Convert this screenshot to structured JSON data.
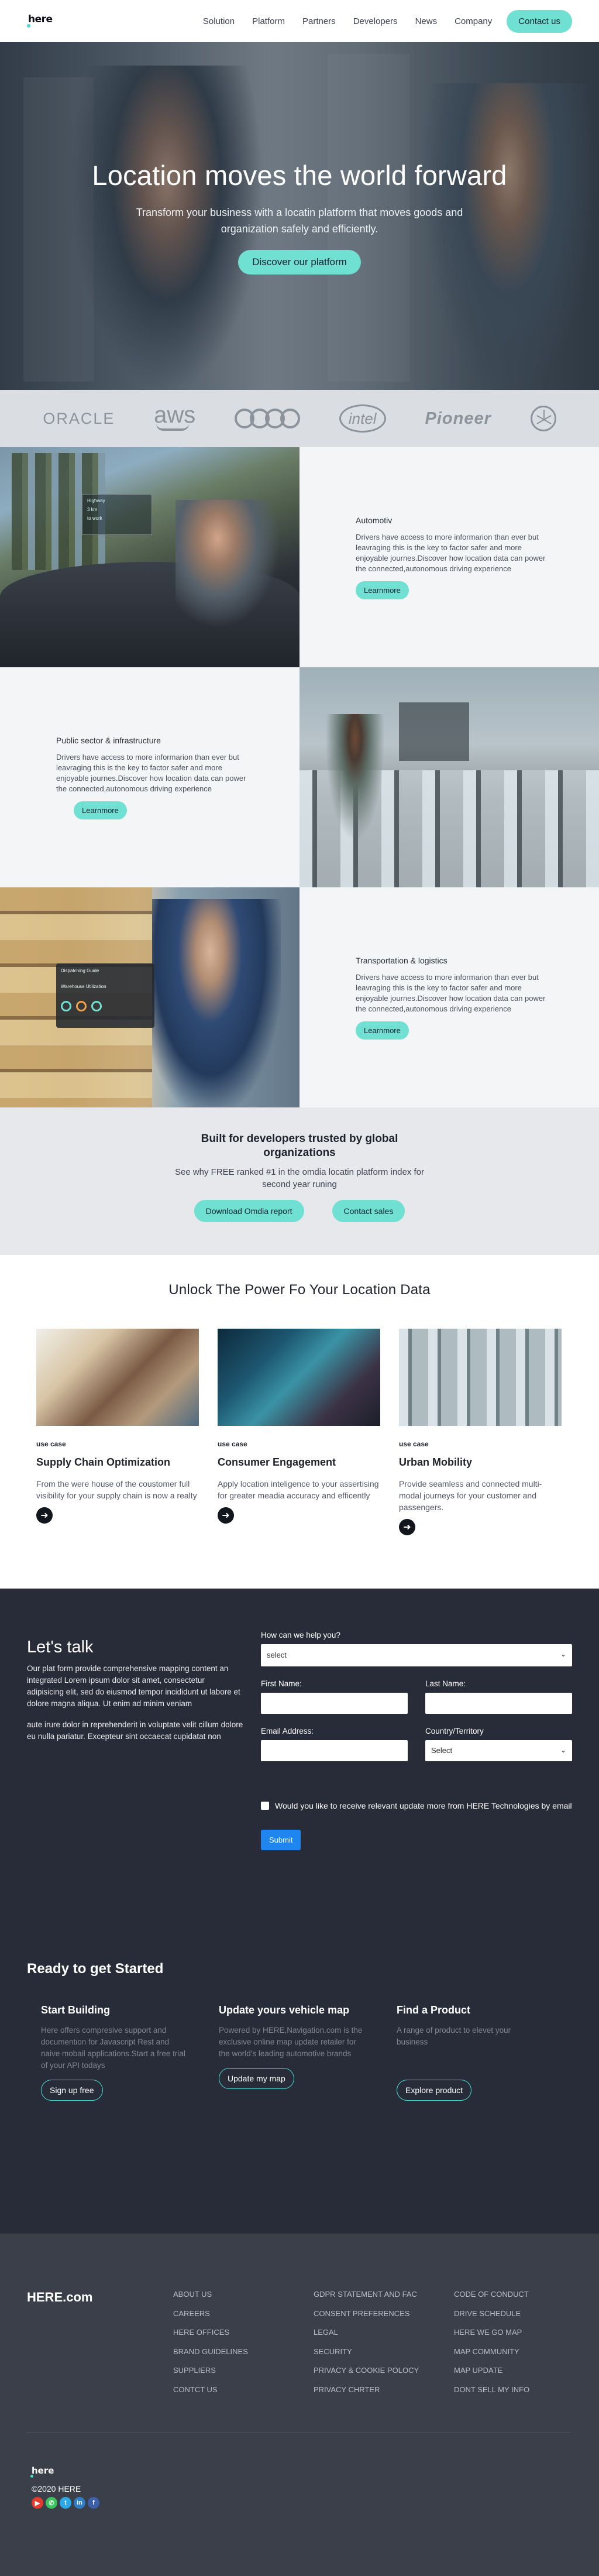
{
  "nav": {
    "logo": "here",
    "links": [
      "Solution",
      "Platform",
      "Partners",
      "Developers",
      "News",
      "Company"
    ],
    "cta": "Contact us"
  },
  "hero": {
    "title": "Location moves the world forward",
    "subtitle": "Transform your business with a locatin platform that moves goods and organization safely and efficiently.",
    "button": "Discover our platform"
  },
  "partners": [
    "ORACLE",
    "aws",
    "audi",
    "intel",
    "Pioneer",
    "mercedes"
  ],
  "industries": [
    {
      "title": "Automotiv",
      "body": "Drivers have access to more informarion than ever but leavraging this is the key to factor safer and more enjoyable journes.Discover how location data can power the connected,autonomous driving experience",
      "button": "Learnmore",
      "hud": [
        "Highway",
        "3 km",
        "to work"
      ]
    },
    {
      "title": "Public sector & infrastructure",
      "body": "Drivers have access to more informarion than ever but leavraging this is the key to factor safer and more enjoyable journes.Discover how location data can power the connected,autonomous driving experience",
      "button": "Learnmore"
    },
    {
      "title": "Transportation & logistics",
      "body": "Drivers have access to more informarion than ever but leavraging this is the key to factor safer and more enjoyable journes.Discover how location data can power the connected,autonomous driving experience",
      "button": "Learnmore",
      "panel": [
        "Dispatching Guide",
        "Warehouse Utilization"
      ]
    }
  ],
  "trusted": {
    "title": "Built for developers trusted by global organizations",
    "subtitle": "See why FREE ranked #1 in the omdia locatin platform index for second year runing",
    "button1": "Download Omdia report",
    "button2": "Contact sales"
  },
  "unlock": {
    "title": "Unlock The Power Fo Your Location Data",
    "cards": [
      {
        "tag": "use case",
        "title": "Supply Chain Optimization",
        "body": "From the were house of the coustomer full visibility for your supply chain is now a realty"
      },
      {
        "tag": "use case",
        "title": "Consumer Engagement",
        "body": "Apply location inteligence to your assertising for greater meadia accuracy and efficently"
      },
      {
        "tag": "use case",
        "title": "Urban Mobility",
        "body": "Provide seamless and connected multi-modal journeys for your customer and passengers."
      }
    ]
  },
  "talk": {
    "title": "Let's talk",
    "p1": "Our plat form provide comprehensive mapping content an integrated Lorem ipsum dolor sit amet, consectetur adipisicing elit, sed do eiusmod tempor incididunt ut labore et dolore magna aliqua. Ut enim ad minim veniam",
    "p2": "aute irure dolor in reprehenderit in voluptate velit cillum dolore eu nulla pariatur. Excepteur sint occaecat cupidatat non",
    "help_label": "How can we help you?",
    "help_value": "select",
    "first_name": "First Name:",
    "last_name": "Last Name:",
    "email": "Email Address:",
    "country": "Country/Territory",
    "country_value": "Select",
    "checkbox": "Would you like to receive relevant update more from HERE Technologies by email",
    "submit": "Submit"
  },
  "ready": {
    "title": "Ready to get Started",
    "cols": [
      {
        "title": "Start Building",
        "body": "Here offers compresive support and documention for Javascript Rest and naive mobail applications.Start a free trial of your API todays",
        "button": "Sign up free"
      },
      {
        "title": "Update yours vehicle map",
        "body": "Powered by HERE,Navigation.com is the exclusive online map update retailer for the world's leading automotive brands",
        "button": "Update my map"
      },
      {
        "title": "Find a Product",
        "body": "A range of product to elevet your business",
        "button": "Explore product"
      }
    ]
  },
  "footer": {
    "brand": "HERE.com",
    "col1": [
      "ABOUT US",
      "CAREERS",
      "HERE OFFICES",
      "BRAND GUIDELINES",
      "SUPPLIERS",
      "CONTCT US"
    ],
    "col2": [
      "GDPR STATEMENT AND FAC",
      "CONSENT PREFERENCES",
      "LEGAL",
      "SECURITY",
      "PRIVACY & COOKIE POLOCY",
      "PRIVACY CHRTER"
    ],
    "col3": [
      "CODE OF CONDUCT",
      "DRIVE SCHEDULE",
      "HERE WE GO MAP",
      "MAP COMMUNITY",
      "MAP UPDATE",
      "DONT SELL MY INFO"
    ],
    "logo": "here",
    "copyright": "©2020 HERE",
    "social": [
      "youtube",
      "whatsapp",
      "twitter",
      "linkedin",
      "facebook"
    ],
    "social_colors": [
      "#e33b2f",
      "#3cc35d",
      "#2aa8e8",
      "#2f7dc2",
      "#3b5fa8"
    ],
    "social_glyphs": [
      "▶",
      "✆",
      "t",
      "in",
      "f"
    ]
  }
}
